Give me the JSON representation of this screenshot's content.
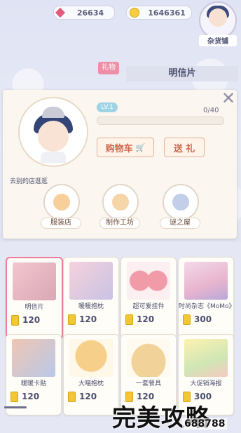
{
  "currency": {
    "gems": "26634",
    "coins": "1646361"
  },
  "owner": {
    "label": "杂货铺"
  },
  "header": {
    "gift_tag": "礼物",
    "item_title": "明信片"
  },
  "card": {
    "level": "LV.1",
    "progress_text": "0/40",
    "progress_value": 0,
    "cart_label": "购物车",
    "gift_label": "送 礼",
    "visited_label": "去别的店逛逛",
    "shops": [
      {
        "name": "服装店"
      },
      {
        "name": "制作工坊"
      },
      {
        "name": "谜之屋"
      }
    ]
  },
  "items": [
    {
      "name": "明信片",
      "price": "120",
      "selected": true
    },
    {
      "name": "暖暖抱枕",
      "price": "120"
    },
    {
      "name": "超可爱挂件",
      "price": "120"
    },
    {
      "name": "时尚杂志《MoMo》",
      "price": "300"
    },
    {
      "name": "暖暖卡贴",
      "price": "120"
    },
    {
      "name": "大喵抱枕",
      "price": "120"
    },
    {
      "name": "一套餐具",
      "price": "120"
    },
    {
      "name": "大促销海报",
      "price": "300"
    }
  ],
  "watermark": {
    "text": "完美攻略",
    "number": "688788"
  },
  "colors": {
    "accent_pink": "#ee8fa8",
    "level_blue": "#9fd3e6",
    "button_text": "#cf6a4f"
  }
}
